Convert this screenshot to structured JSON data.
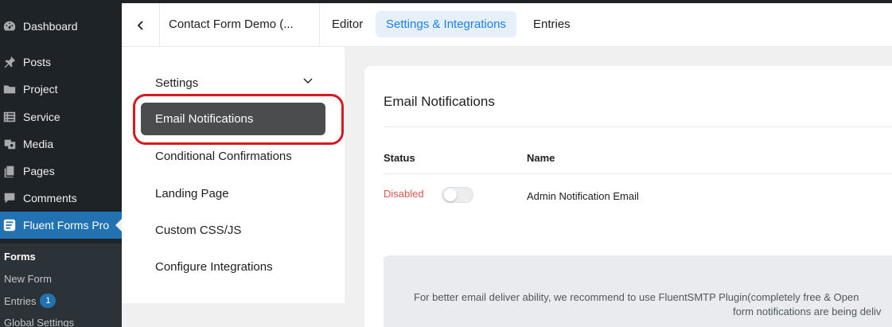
{
  "wp_menu": {
    "items": [
      {
        "label": "Dashboard",
        "icon": "dashboard-icon"
      },
      {
        "label": "Posts",
        "icon": "pin-icon"
      },
      {
        "label": "Project",
        "icon": "folder-icon"
      },
      {
        "label": "Service",
        "icon": "list-icon"
      },
      {
        "label": "Media",
        "icon": "media-icon"
      },
      {
        "label": "Pages",
        "icon": "pages-icon"
      },
      {
        "label": "Comments",
        "icon": "comment-icon"
      },
      {
        "label": "Fluent Forms Pro",
        "icon": "fluent-forms-icon"
      }
    ],
    "submenu": {
      "forms": "Forms",
      "new_form": "New Form",
      "entries": "Entries",
      "entries_count": "1",
      "global_settings": "Global Settings"
    }
  },
  "header": {
    "form_title": "Contact Form Demo (...",
    "tabs": [
      {
        "label": "Editor"
      },
      {
        "label": "Settings & Integrations"
      },
      {
        "label": "Entries"
      }
    ]
  },
  "settings_menu": {
    "items": [
      {
        "label": "Settings"
      },
      {
        "label": "Email Notifications"
      },
      {
        "label": "Conditional Confirmations"
      },
      {
        "label": "Landing Page"
      },
      {
        "label": "Custom CSS/JS"
      },
      {
        "label": "Configure Integrations"
      }
    ]
  },
  "panel": {
    "title": "Email Notifications",
    "columns": {
      "status": "Status",
      "name": "Name"
    },
    "rows": [
      {
        "status": "Disabled",
        "enabled": false,
        "name": "Admin Notification Email"
      }
    ],
    "notice_line1": "For better email deliver ability, we recommend to use FluentSMTP Plugin(completely free & Open",
    "notice_line2": "form notifications are being deliv"
  },
  "colors": {
    "accent": "#1a7efb",
    "wp_sidebar": "#1d2327",
    "wp_active": "#2271b1",
    "disabled": "#e0544f",
    "highlight_ring": "#d71920"
  }
}
